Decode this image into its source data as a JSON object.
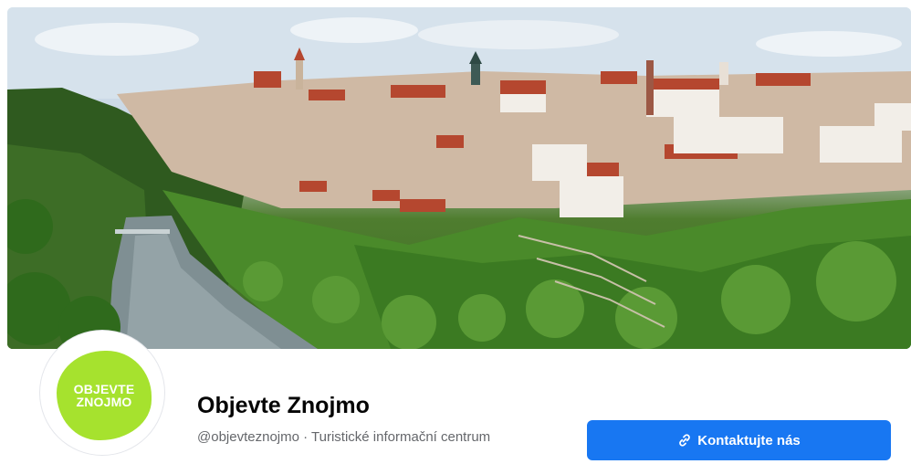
{
  "page": {
    "name": "Objevte Znojmo",
    "handle": "@objevteznojmo",
    "separator": " · ",
    "category": "Turistické informační centrum"
  },
  "avatar": {
    "logo_text": "OBJEVTE\nZNOJMO",
    "logo_color": "#a6e22e"
  },
  "contact_button": {
    "label": "Kontaktujte nás",
    "icon": "link-icon",
    "color": "#1877f2"
  },
  "cover_photo": {
    "icon": "cover-photo"
  }
}
